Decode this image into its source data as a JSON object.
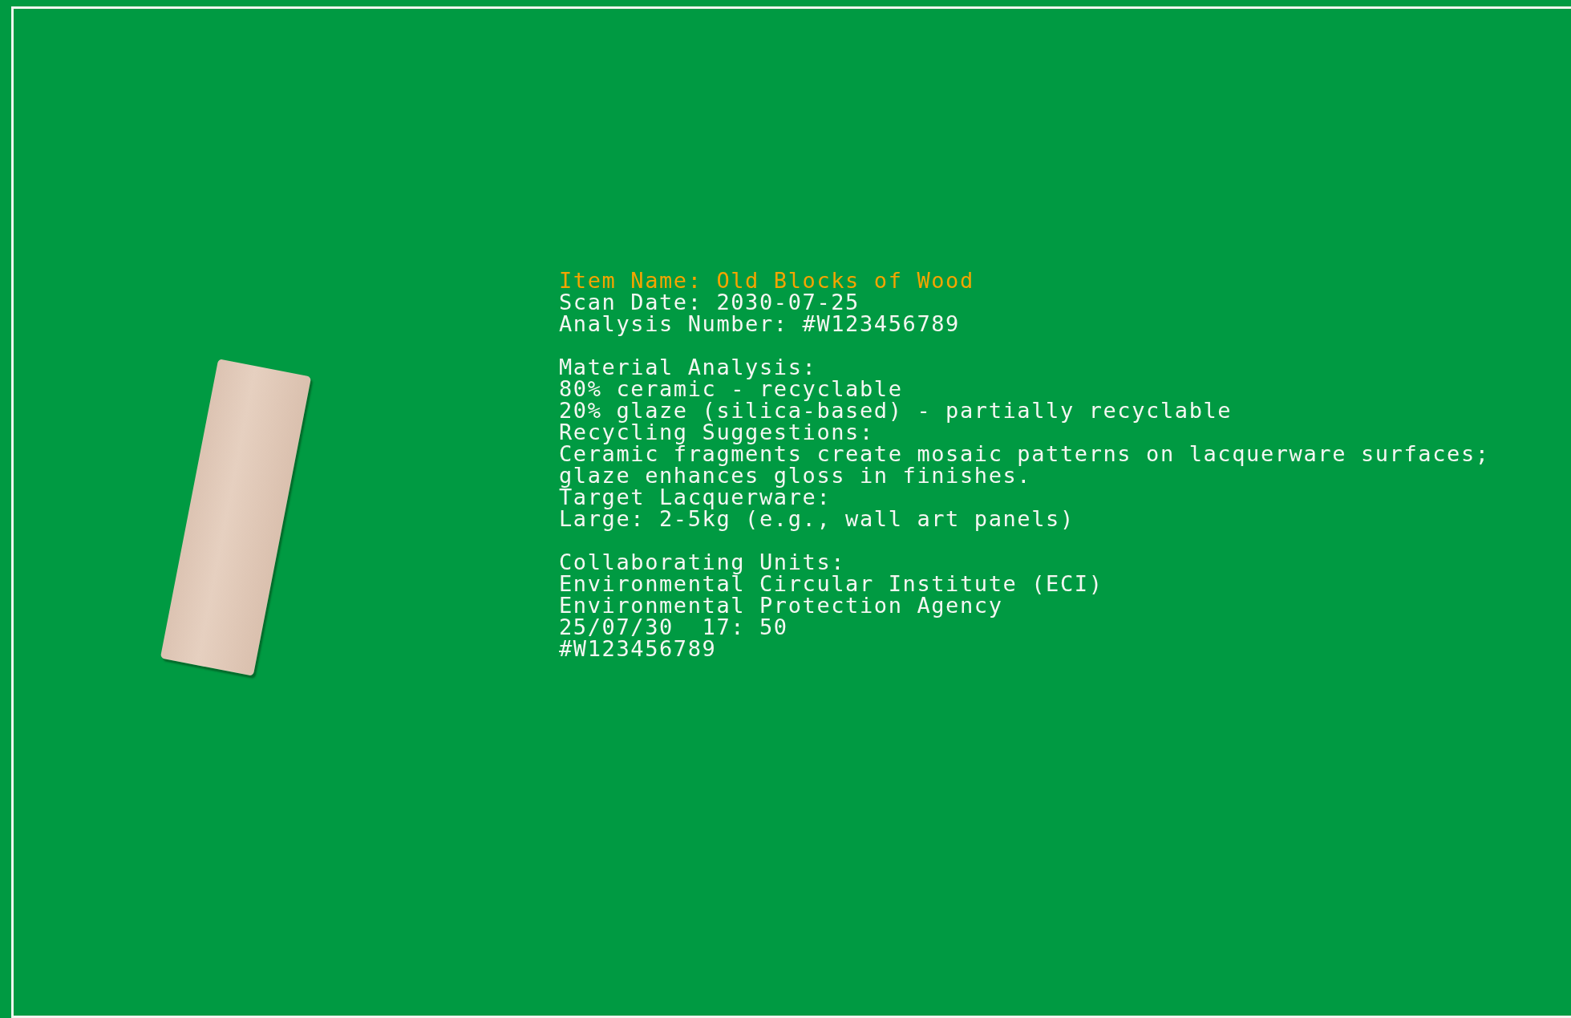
{
  "header": [
    {
      "text": "Item Name: Old Blocks of Wood",
      "kind": "highlight"
    },
    {
      "text": "Scan Date: 2030-07-25",
      "kind": "plain"
    },
    {
      "text": "Analysis Number: #W123456789",
      "kind": "plain"
    }
  ],
  "analysis": [
    "Material Analysis:",
    "80% ceramic - recyclable",
    "20% glaze (silica-based) - partially recyclable",
    "Recycling Suggestions:",
    "Ceramic fragments create mosaic patterns on lacquerware surfaces;",
    "glaze enhances gloss in finishes.",
    "Target Lacquerware:",
    "Large: 2-5kg (e.g., wall art panels)"
  ],
  "collaboration": [
    "Collaborating Units:",
    "Environmental Circular Institute (ECI)",
    "Environmental Protection Agency",
    "25/07/30  17: 50",
    "#W123456789"
  ]
}
